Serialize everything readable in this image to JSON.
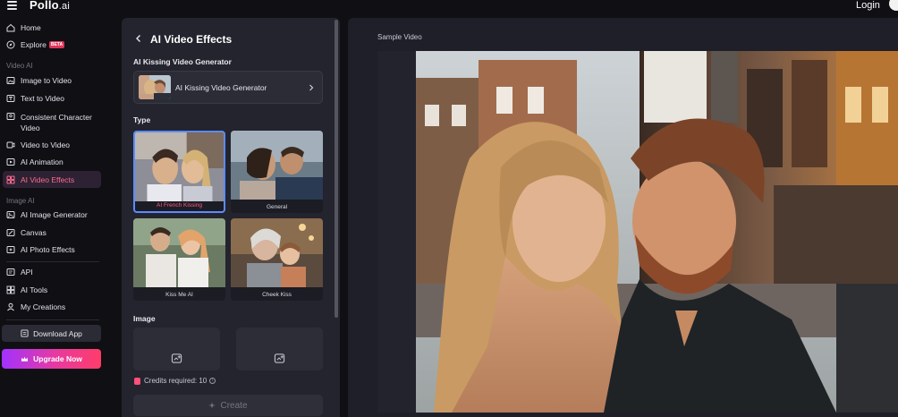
{
  "topbar": {
    "logo_main": "Pollo",
    "logo_suffix": ".ai",
    "login": "Login"
  },
  "sidebar": {
    "top_items": [
      {
        "label": "Home",
        "icon": "home-icon"
      },
      {
        "label": "Explore",
        "icon": "compass-icon",
        "badge": "BETA"
      }
    ],
    "video_section": "Video AI",
    "video_items": [
      {
        "label": "Image to Video",
        "icon": "image-icon"
      },
      {
        "label": "Text to Video",
        "icon": "text-icon"
      },
      {
        "label": "Consistent Character",
        "label2": "Video",
        "icon": "character-icon"
      },
      {
        "label": "Video to Video",
        "icon": "video-icon"
      },
      {
        "label": "AI Animation",
        "icon": "animation-icon"
      },
      {
        "label": "AI Video Effects",
        "icon": "effects-icon",
        "active": true
      }
    ],
    "image_section": "Image AI",
    "image_items": [
      {
        "label": "AI Image Generator",
        "icon": "image-gen-icon"
      },
      {
        "label": "Canvas",
        "icon": "canvas-icon"
      },
      {
        "label": "AI Photo Effects",
        "icon": "photo-effects-icon"
      }
    ],
    "bottom_items": [
      {
        "label": "API",
        "icon": "api-icon"
      },
      {
        "label": "AI Tools",
        "icon": "tools-icon"
      },
      {
        "label": "My Creations",
        "icon": "creations-icon"
      }
    ],
    "download_label": "Download App",
    "upgrade_label": "Upgrade Now"
  },
  "panel": {
    "title": "AI Video Effects",
    "generator_heading": "AI Kissing Video Generator",
    "generator_card_label": "AI Kissing Video Generator",
    "type_heading": "Type",
    "effects": [
      {
        "label": "AI French Kissing",
        "selected": true
      },
      {
        "label": "General",
        "selected": false
      },
      {
        "label": "Kiss Me AI",
        "selected": false
      },
      {
        "label": "Cheek Kiss",
        "selected": false
      }
    ],
    "image_heading": "Image",
    "credits_text": "Credits required: 10",
    "create_label": "Create"
  },
  "video": {
    "label": "Sample Video"
  },
  "colors": {
    "accent_pink": "#ff5b87",
    "selected_border": "#5b8cff",
    "upgrade_start": "#a232ff",
    "upgrade_end": "#ff3d6a"
  }
}
